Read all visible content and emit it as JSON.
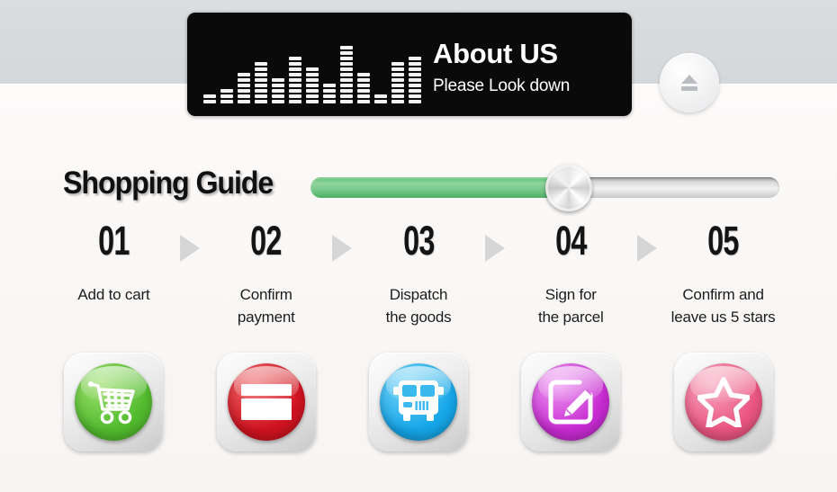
{
  "page": {
    "background_top": "#d9dcdf",
    "background_bottom": "#faf8f6"
  },
  "header": {
    "title": "About US",
    "subtitle": "Please Look down",
    "panel_color": "#0a0a0a",
    "equalizer": {
      "name": "equalizer-graphic",
      "bar_count": 13,
      "segments": [
        2,
        3,
        6,
        8,
        5,
        9,
        7,
        4,
        11,
        6,
        2,
        8,
        9
      ],
      "segment_color": "#f2f2f2"
    },
    "eject_button": {
      "label": "eject",
      "icon": "eject-icon"
    }
  },
  "guide": {
    "title": "Shopping Guide",
    "slider": {
      "fill_percent": 55,
      "fill_color": "#6cc47f",
      "track_color": "#e8e8e8",
      "knob_color": "#e0e0e0"
    }
  },
  "steps": [
    {
      "number": "01",
      "label_line1": "Add to cart",
      "label_line2": "",
      "icon": "shopping-cart-icon",
      "color": "#52bb2e",
      "color_light": "#9ee06f"
    },
    {
      "number": "02",
      "label_line1": "Confirm",
      "label_line2": "payment",
      "icon": "credit-card-icon",
      "color": "#cf1320",
      "color_light": "#f06a6a"
    },
    {
      "number": "03",
      "label_line1": "Dispatch",
      "label_line2": "the goods",
      "icon": "delivery-bus-icon",
      "color": "#15a6e8",
      "color_light": "#79d6f7"
    },
    {
      "number": "04",
      "label_line1": "Sign for",
      "label_line2": "the parcel",
      "icon": "sign-pencil-icon",
      "color": "#c82bd2",
      "color_light": "#ee9df2"
    },
    {
      "number": "05",
      "label_line1": "Confirm and",
      "label_line2": "leave us 5 stars",
      "icon": "star-icon",
      "color": "#ea5580",
      "color_light": "#f7a9c1"
    }
  ],
  "arrows": {
    "icon": "triangle-right-icon",
    "color": "#d6d6d6",
    "count": 4
  }
}
